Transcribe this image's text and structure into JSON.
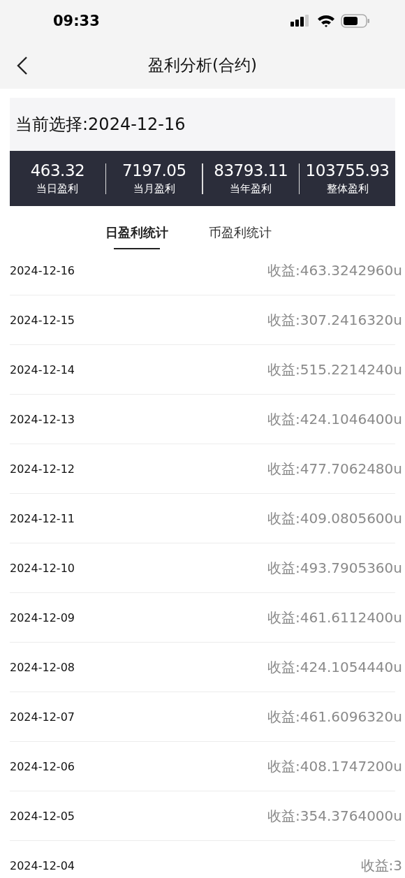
{
  "status_bar": {
    "time": "09:33"
  },
  "nav_bar": {
    "title": "盈利分析(合约)"
  },
  "selection": {
    "label": "当前选择:2024-12-16"
  },
  "summary": [
    {
      "value": "463.32",
      "label": "当日盈利"
    },
    {
      "value": "7197.05",
      "label": "当月盈利"
    },
    {
      "value": "83793.11",
      "label": "当年盈利"
    },
    {
      "value": "103755.93",
      "label": "整体盈利"
    }
  ],
  "tabs": [
    {
      "label": "日盈利统计",
      "selected": true
    },
    {
      "label": "币盈利统计",
      "selected": false
    }
  ],
  "rows": [
    {
      "date": "2024-12-16",
      "profit": "收益:463.3242960u"
    },
    {
      "date": "2024-12-15",
      "profit": "收益:307.2416320u"
    },
    {
      "date": "2024-12-14",
      "profit": "收益:515.2214240u"
    },
    {
      "date": "2024-12-13",
      "profit": "收益:424.1046400u"
    },
    {
      "date": "2024-12-12",
      "profit": "收益:477.7062480u"
    },
    {
      "date": "2024-12-11",
      "profit": "收益:409.0805600u"
    },
    {
      "date": "2024-12-10",
      "profit": "收益:493.7905360u"
    },
    {
      "date": "2024-12-09",
      "profit": "收益:461.6112400u"
    },
    {
      "date": "2024-12-08",
      "profit": "收益:424.1054440u"
    },
    {
      "date": "2024-12-07",
      "profit": "收益:461.6096320u"
    },
    {
      "date": "2024-12-06",
      "profit": "收益:408.1747200u"
    },
    {
      "date": "2024-12-05",
      "profit": "收益:354.3764000u"
    },
    {
      "date": "2024-12-04",
      "profit": "收益:3"
    }
  ]
}
